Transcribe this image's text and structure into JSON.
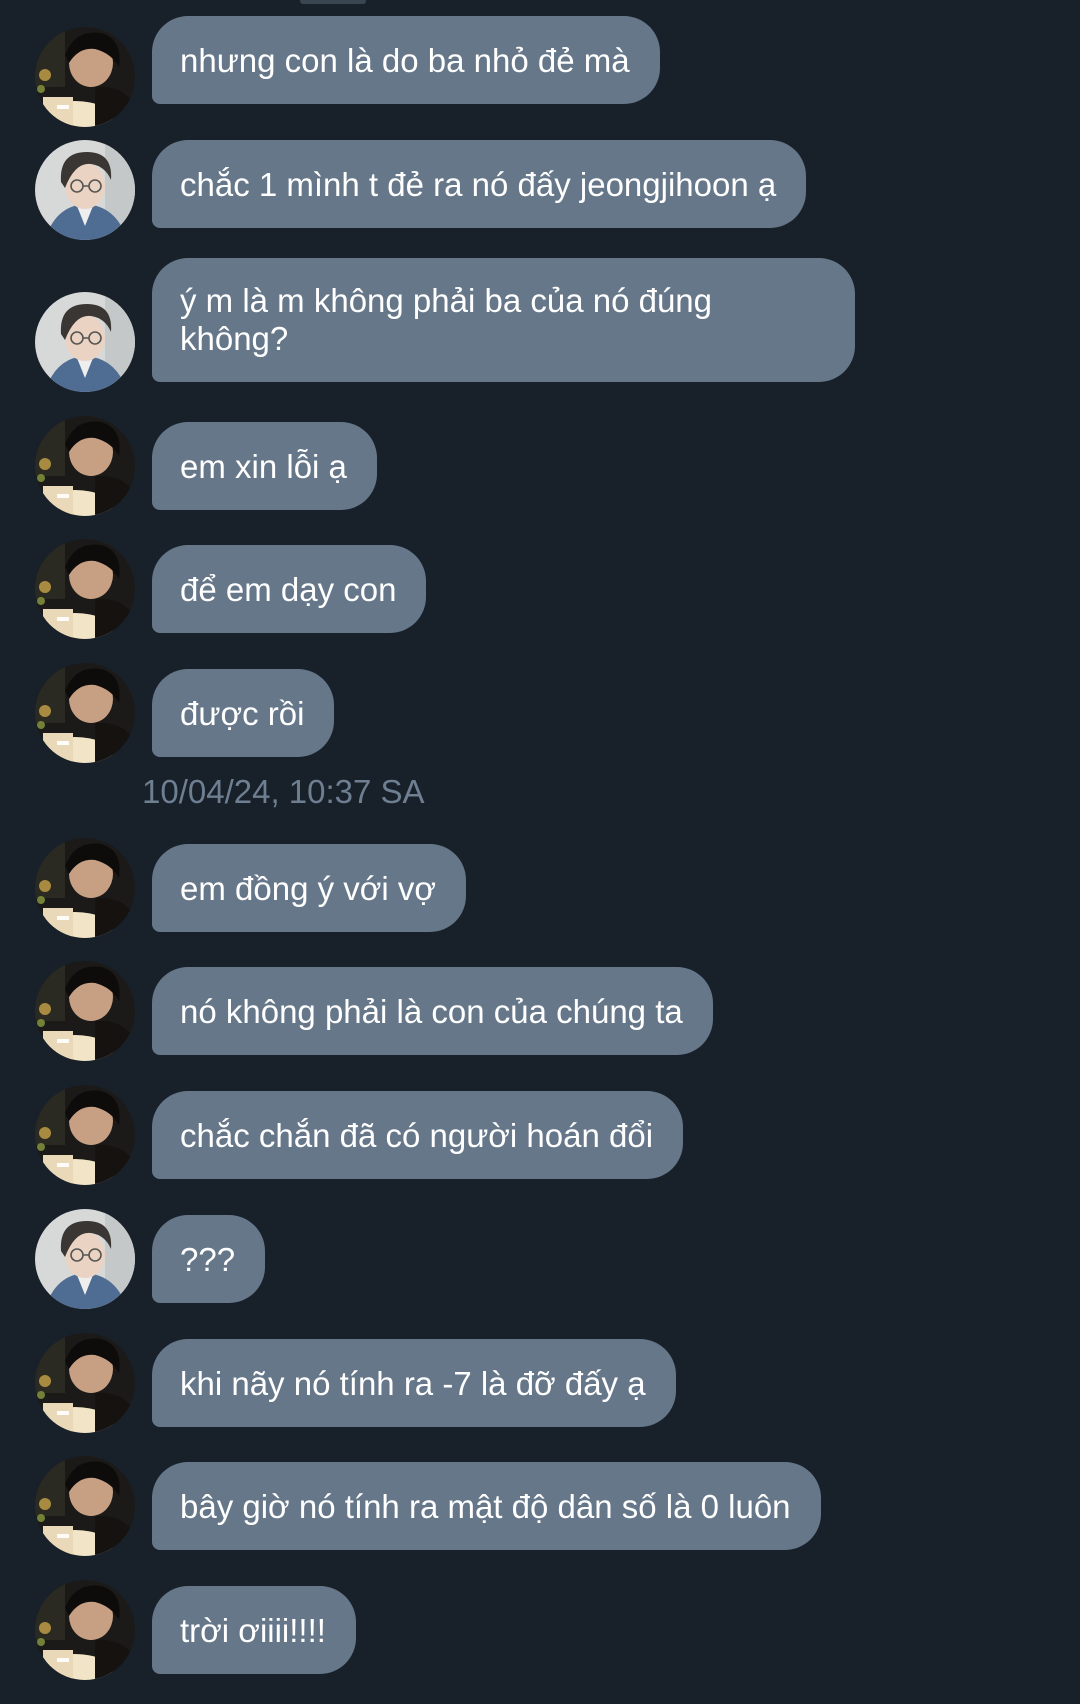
{
  "messages": [
    {
      "sender": "a",
      "text": "nhưng con là do ba nhỏ đẻ mà"
    },
    {
      "sender": "b",
      "text": "chắc 1 mình t đẻ ra nó đấy jeongjihoon ạ"
    },
    {
      "sender": "b",
      "text": "ý m là m không phải ba của nó đúng không?"
    },
    {
      "sender": "a",
      "text": "em xin lỗi ạ"
    },
    {
      "sender": "a",
      "text": "để em dạy con"
    },
    {
      "sender": "a",
      "text": "được rồi"
    },
    {
      "sender": "a",
      "text": "em đồng ý với vợ"
    },
    {
      "sender": "a",
      "text": "nó không phải là con của chúng ta"
    },
    {
      "sender": "a",
      "text": "chắc chắn đã có người hoán đổi"
    },
    {
      "sender": "b",
      "text": "???"
    },
    {
      "sender": "a",
      "text": "khi nãy nó tính ra -7 là đỡ đấy ạ"
    },
    {
      "sender": "a",
      "text": "bây giờ nó tính ra mật độ dân số là 0 luôn"
    },
    {
      "sender": "a",
      "text": "trời ơiiii!!!!"
    }
  ],
  "timestamp": "10/04/24, 10:37 SA",
  "colors": {
    "background": "#18202a",
    "bubble": "#66778a",
    "text": "#ffffff",
    "timestamp": "#6f7f92"
  }
}
